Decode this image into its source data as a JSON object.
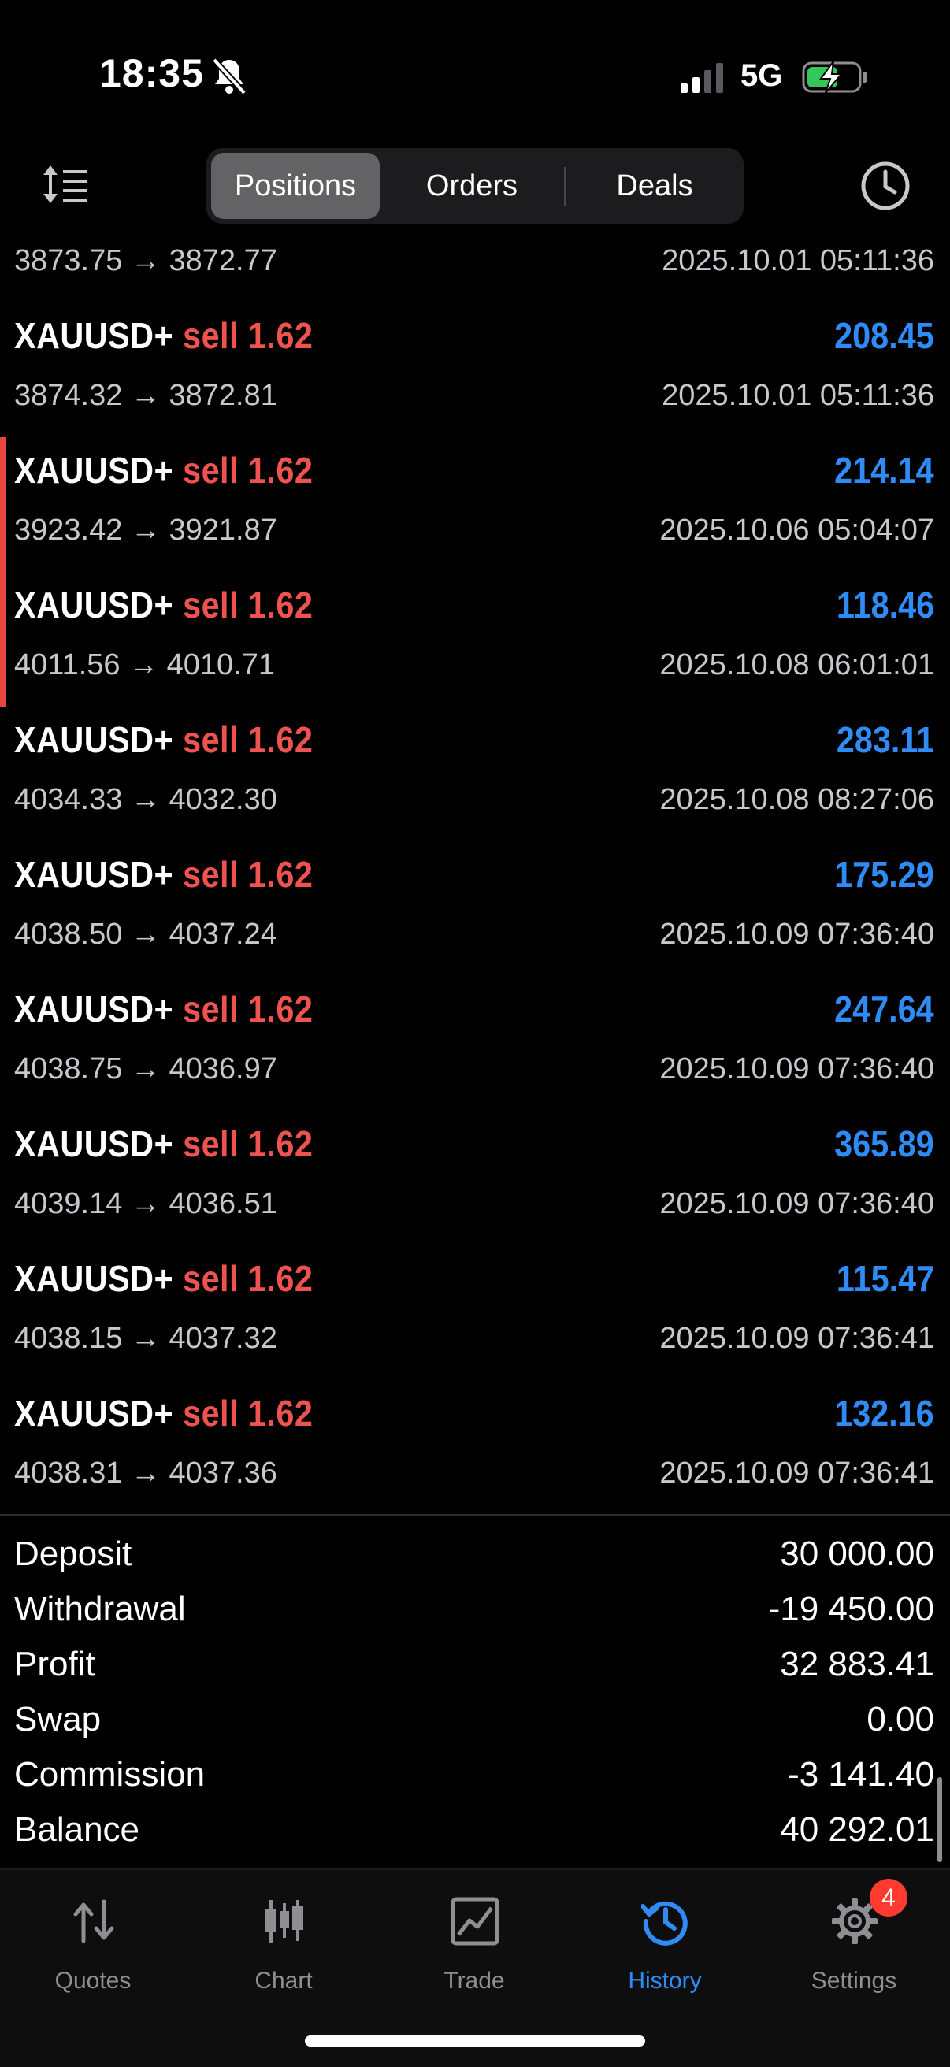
{
  "status_bar": {
    "time": "18:35",
    "network": "5G",
    "icons": [
      "bell-slash-icon",
      "signal-icon",
      "battery-charging-icon"
    ]
  },
  "toolbar": {
    "tabs": [
      {
        "label": "Positions",
        "active": true
      },
      {
        "label": "Orders",
        "active": false
      },
      {
        "label": "Deals",
        "active": false
      }
    ],
    "icons": [
      "sort-icon",
      "clock-icon"
    ]
  },
  "colors": {
    "sell": "#ef5350",
    "profit": "#2f8cf7",
    "accent": "#2f8cf7",
    "marker": "#e8453c",
    "badge": "#ff3b30"
  },
  "partial_row": {
    "prices": "3873.75 → 3872.77",
    "time": "2025.10.01 05:11:36"
  },
  "positions": [
    {
      "symbol": "XAUUSD+",
      "side": "sell",
      "volume": "1.62",
      "prices": "3874.32 → 3872.81",
      "time": "2025.10.01 05:11:36",
      "profit": "208.45"
    },
    {
      "symbol": "XAUUSD+",
      "side": "sell",
      "volume": "1.62",
      "prices": "3923.42 → 3921.87",
      "time": "2025.10.06 05:04:07",
      "profit": "214.14"
    },
    {
      "symbol": "XAUUSD+",
      "side": "sell",
      "volume": "1.62",
      "prices": "4011.56 → 4010.71",
      "time": "2025.10.08 06:01:01",
      "profit": "118.46"
    },
    {
      "symbol": "XAUUSD+",
      "side": "sell",
      "volume": "1.62",
      "prices": "4034.33 → 4032.30",
      "time": "2025.10.08 08:27:06",
      "profit": "283.11"
    },
    {
      "symbol": "XAUUSD+",
      "side": "sell",
      "volume": "1.62",
      "prices": "4038.50 → 4037.24",
      "time": "2025.10.09 07:36:40",
      "profit": "175.29"
    },
    {
      "symbol": "XAUUSD+",
      "side": "sell",
      "volume": "1.62",
      "prices": "4038.75 → 4036.97",
      "time": "2025.10.09 07:36:40",
      "profit": "247.64"
    },
    {
      "symbol": "XAUUSD+",
      "side": "sell",
      "volume": "1.62",
      "prices": "4039.14 → 4036.51",
      "time": "2025.10.09 07:36:40",
      "profit": "365.89"
    },
    {
      "symbol": "XAUUSD+",
      "side": "sell",
      "volume": "1.62",
      "prices": "4038.15 → 4037.32",
      "time": "2025.10.09 07:36:41",
      "profit": "115.47"
    },
    {
      "symbol": "XAUUSD+",
      "side": "sell",
      "volume": "1.62",
      "prices": "4038.31 → 4037.36",
      "time": "2025.10.09 07:36:41",
      "profit": "132.16"
    }
  ],
  "summary": [
    {
      "label": "Deposit",
      "value": "30 000.00"
    },
    {
      "label": "Withdrawal",
      "value": "-19 450.00"
    },
    {
      "label": "Profit",
      "value": "32 883.41"
    },
    {
      "label": "Swap",
      "value": "0.00"
    },
    {
      "label": "Commission",
      "value": "-3 141.40"
    },
    {
      "label": "Balance",
      "value": "40 292.01"
    }
  ],
  "tabbar": {
    "items": [
      {
        "label": "Quotes",
        "icon": "quotes-icon",
        "active": false
      },
      {
        "label": "Chart",
        "icon": "candlestick-icon",
        "active": false
      },
      {
        "label": "Trade",
        "icon": "trade-chart-icon",
        "active": false
      },
      {
        "label": "History",
        "icon": "history-icon",
        "active": true
      },
      {
        "label": "Settings",
        "icon": "gear-icon",
        "active": false
      }
    ],
    "settings_badge": "4"
  }
}
